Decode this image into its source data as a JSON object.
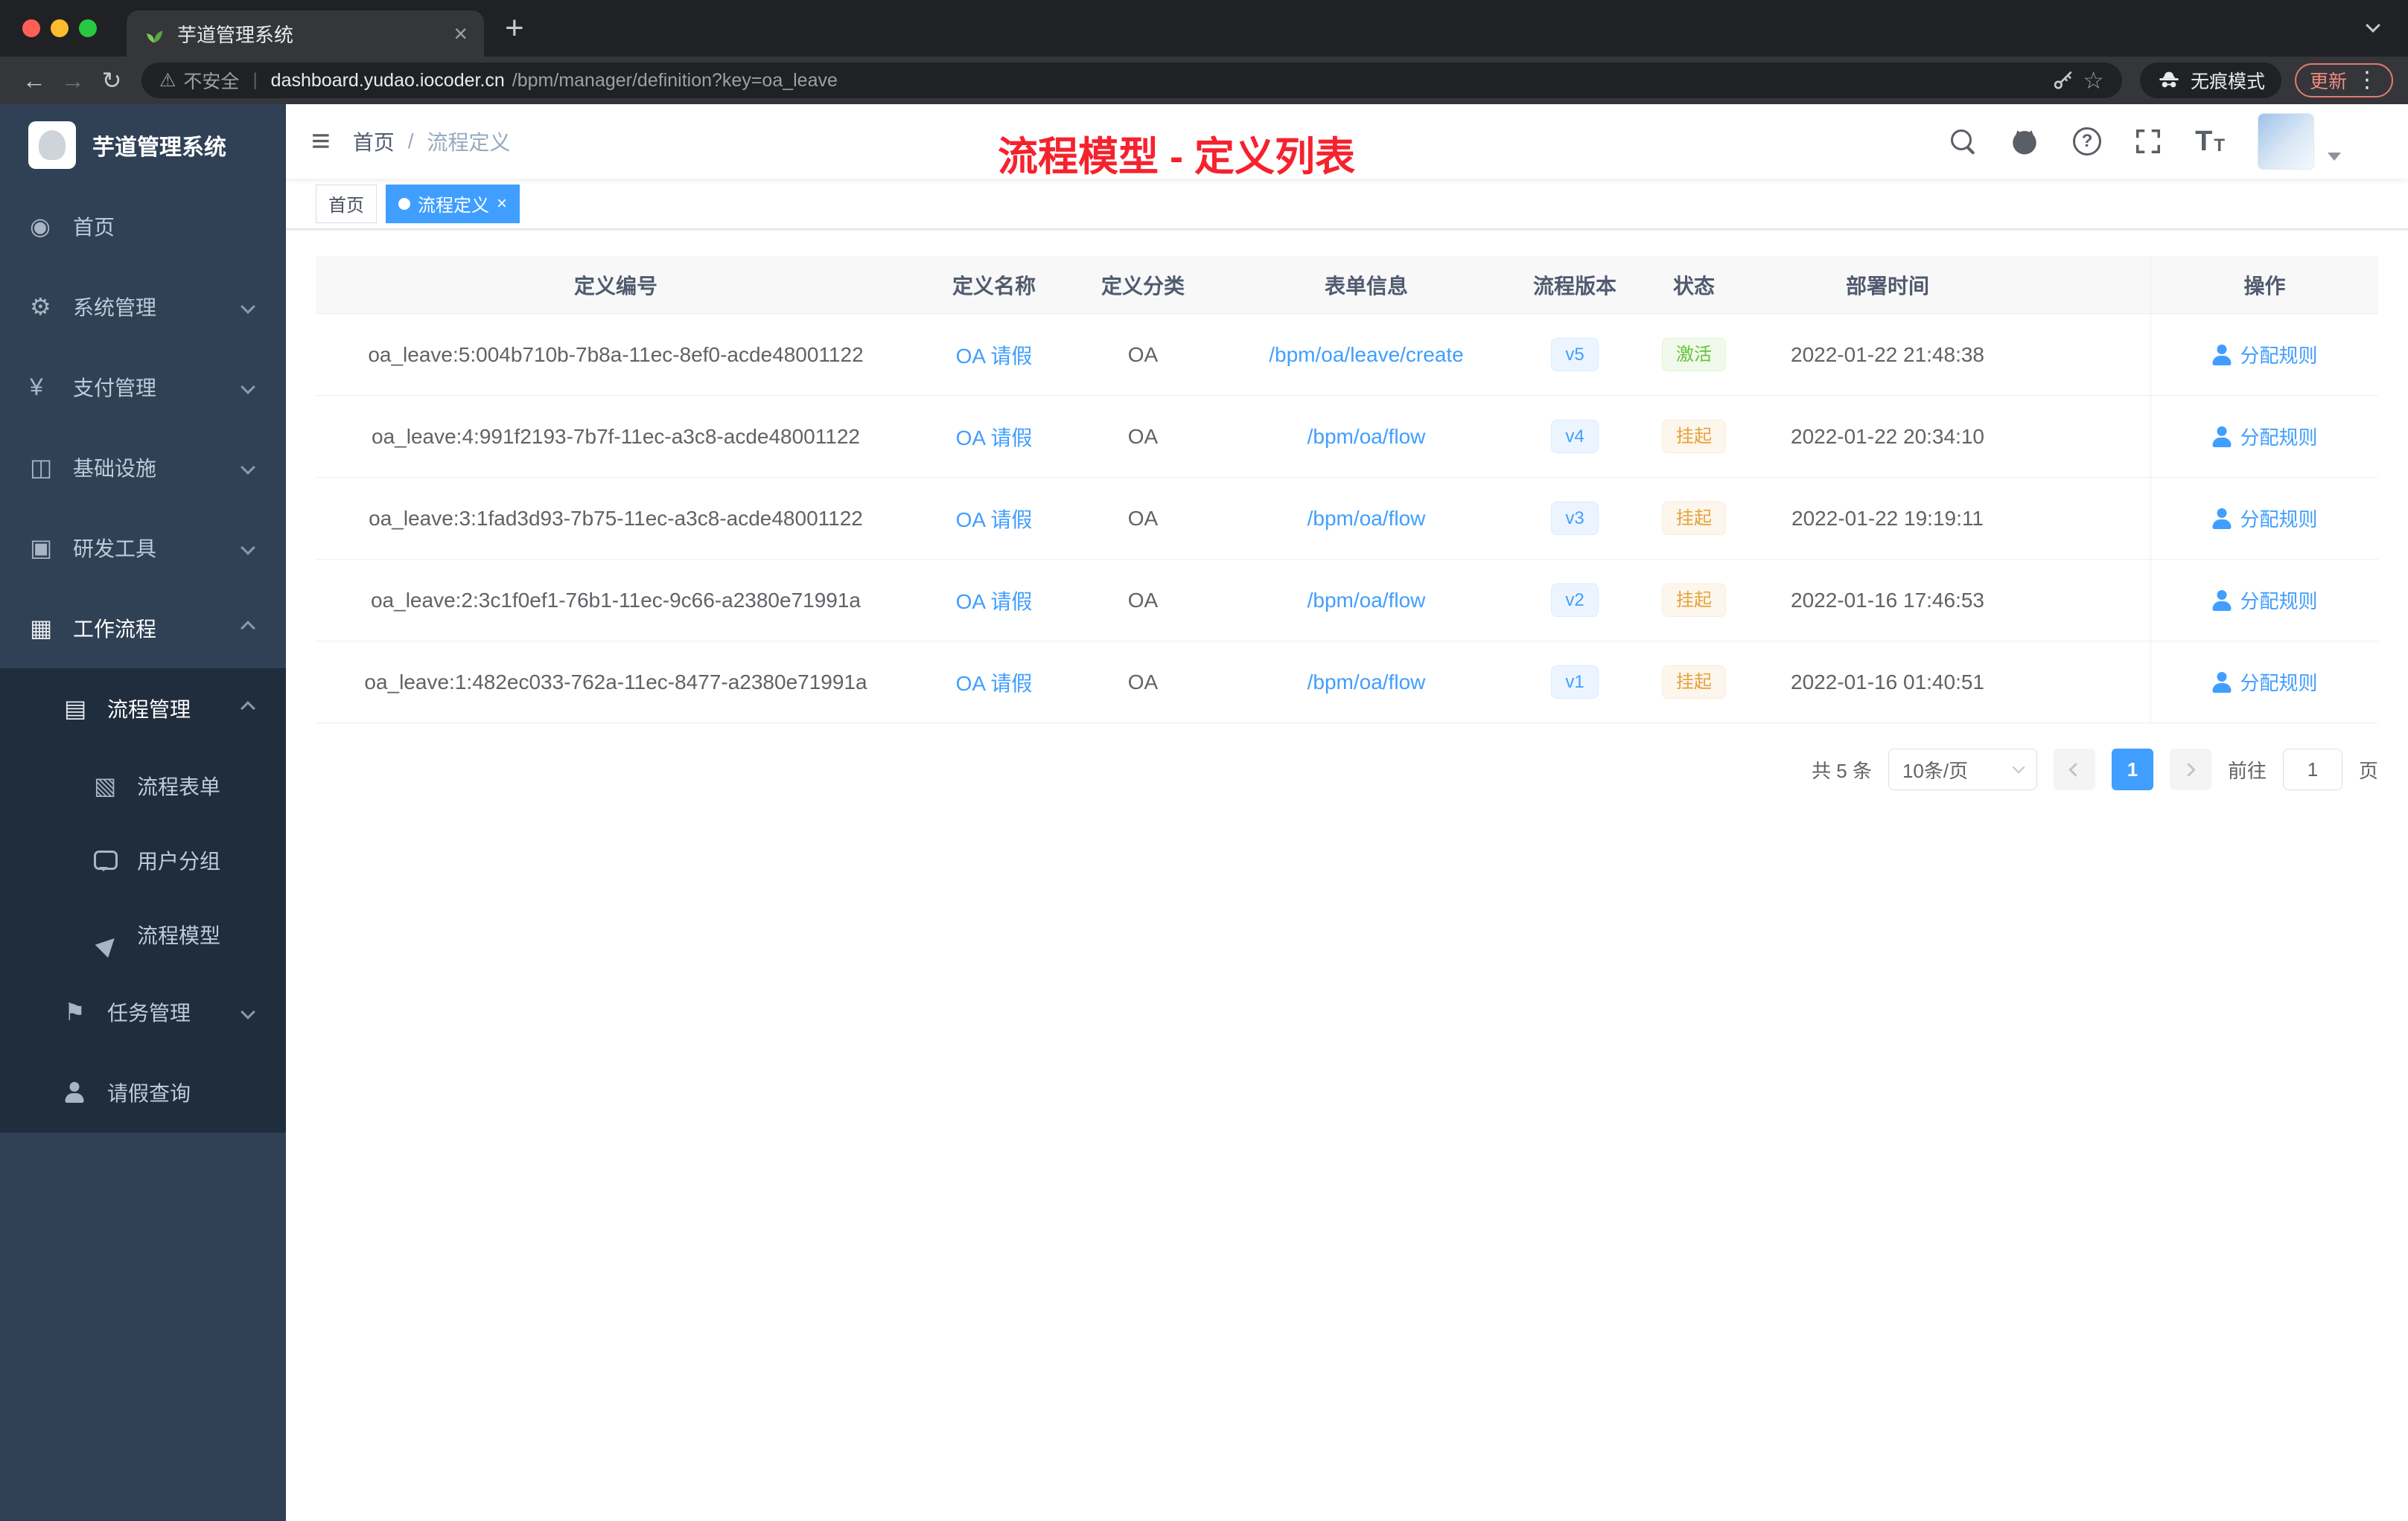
{
  "browser": {
    "tab_title": "芋道管理系统",
    "tab_close": "×",
    "new_tab": "+",
    "security_label": "不安全",
    "url_domain": "dashboard.yudao.iocoder.cn",
    "url_path": "/bpm/manager/definition?key=oa_leave",
    "incognito_label": "无痕模式",
    "update_label": "更新"
  },
  "sidebar": {
    "logo_title": "芋道管理系统",
    "items": [
      {
        "key": "home",
        "label": "首页",
        "icon": "dashboard-icon",
        "level": 1
      },
      {
        "key": "system",
        "label": "系统管理",
        "icon": "gear-icon",
        "level": 1,
        "arrow": "down"
      },
      {
        "key": "payment",
        "label": "支付管理",
        "icon": "yen-icon",
        "level": 1,
        "arrow": "down"
      },
      {
        "key": "infrastructure",
        "label": "基础设施",
        "icon": "infrastructure-icon",
        "level": 1,
        "arrow": "down"
      },
      {
        "key": "dev-tools",
        "label": "研发工具",
        "icon": "tools-icon",
        "level": 1,
        "arrow": "down"
      },
      {
        "key": "workflow",
        "label": "工作流程",
        "icon": "workflow-icon",
        "level": 1,
        "arrow": "up",
        "open": true
      },
      {
        "key": "process-management",
        "label": "流程管理",
        "icon": "process-list-icon",
        "level": 2,
        "arrow": "up",
        "open": true,
        "submenu": true
      },
      {
        "key": "process-form",
        "label": "流程表单",
        "icon": "form-icon",
        "level": 3,
        "submenu": true
      },
      {
        "key": "user-group",
        "label": "用户分组",
        "icon": "chat-bubble-icon",
        "level": 3,
        "submenu": true
      },
      {
        "key": "process-model",
        "label": "流程模型",
        "icon": "send-icon",
        "level": 3,
        "submenu": true
      },
      {
        "key": "task-management",
        "label": "任务管理",
        "icon": "flag-icon",
        "level": 2,
        "arrow": "down",
        "submenu": true
      },
      {
        "key": "leave-query",
        "label": "请假查询",
        "icon": "person-icon",
        "level": 2,
        "submenu": true
      }
    ]
  },
  "header": {
    "breadcrumb": [
      "首页",
      "流程定义"
    ],
    "breadcrumb_sep": "/",
    "overlay_title": "流程模型 - 定义列表"
  },
  "tagsbar": {
    "close_glyph": "×",
    "tags": [
      {
        "label": "首页",
        "active": false,
        "closable": false
      },
      {
        "label": "流程定义",
        "active": true,
        "closable": true
      }
    ]
  },
  "table": {
    "columns": [
      "定义编号",
      "定义名称",
      "定义分类",
      "表单信息",
      "流程版本",
      "状态",
      "部署时间",
      "操作"
    ],
    "rows": [
      {
        "id": "oa_leave:5:004b710b-7b8a-11ec-8ef0-acde48001122",
        "name": "OA 请假",
        "category": "OA",
        "form": "/bpm/oa/leave/create",
        "version": "v5",
        "status": "激活",
        "status_type": "success",
        "deploy_time": "2022-01-22 21:48:38",
        "action": "分配规则"
      },
      {
        "id": "oa_leave:4:991f2193-7b7f-11ec-a3c8-acde48001122",
        "name": "OA 请假",
        "category": "OA",
        "form": "/bpm/oa/flow",
        "version": "v4",
        "status": "挂起",
        "status_type": "warning",
        "deploy_time": "2022-01-22 20:34:10",
        "action": "分配规则"
      },
      {
        "id": "oa_leave:3:1fad3d93-7b75-11ec-a3c8-acde48001122",
        "name": "OA 请假",
        "category": "OA",
        "form": "/bpm/oa/flow",
        "version": "v3",
        "status": "挂起",
        "status_type": "warning",
        "deploy_time": "2022-01-22 19:19:11",
        "action": "分配规则"
      },
      {
        "id": "oa_leave:2:3c1f0ef1-76b1-11ec-9c66-a2380e71991a",
        "name": "OA 请假",
        "category": "OA",
        "form": "/bpm/oa/flow",
        "version": "v2",
        "status": "挂起",
        "status_type": "warning",
        "deploy_time": "2022-01-16 17:46:53",
        "action": "分配规则"
      },
      {
        "id": "oa_leave:1:482ec033-762a-11ec-8477-a2380e71991a",
        "name": "OA 请假",
        "category": "OA",
        "form": "/bpm/oa/flow",
        "version": "v1",
        "status": "挂起",
        "status_type": "warning",
        "deploy_time": "2022-01-16 01:40:51",
        "action": "分配规则"
      }
    ]
  },
  "pagination": {
    "total": "共 5 条",
    "page_size": "10条/页",
    "current_page": "1",
    "goto_label": "前往",
    "goto_value": "1",
    "page_unit": "页"
  },
  "colors": {
    "accent": "#409eff",
    "success": "#67c23a",
    "warning": "#e6a23c",
    "title_red": "#f5222d",
    "sidebar_bg": "#304156",
    "submenu_bg": "#1f2d3d"
  }
}
